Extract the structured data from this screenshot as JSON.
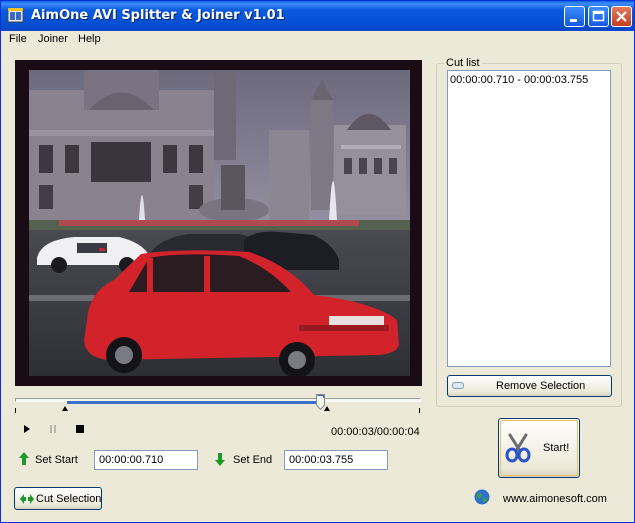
{
  "window": {
    "title": "AimOne AVI Splitter & Joiner v1.01"
  },
  "menu": [
    {
      "label": "File"
    },
    {
      "label": "Joiner"
    },
    {
      "label": "Help"
    }
  ],
  "cut_list": {
    "legend": "Cut list",
    "items": [
      "00:00:00.710 - 00:00:03.755"
    ]
  },
  "buttons": {
    "remove_selection": "Remove Selection",
    "start": "Start!",
    "cut_selection": "Cut Selection"
  },
  "player": {
    "time_display": "00:00:03/00:00:04",
    "position_fraction": 0.79,
    "selection_start_fraction": 0.12,
    "selection_end_fraction": 0.79
  },
  "selection": {
    "set_start_label": "Set Start",
    "start_value": "00:00:00.710",
    "set_end_label": "Set End",
    "end_value": "00:00:03.755"
  },
  "footer": {
    "website": "www.aimonesoft.com"
  },
  "colors": {
    "titlebar": "#0554d8",
    "selection_bar": "#3d6fc9",
    "video_border": "#190c14"
  }
}
